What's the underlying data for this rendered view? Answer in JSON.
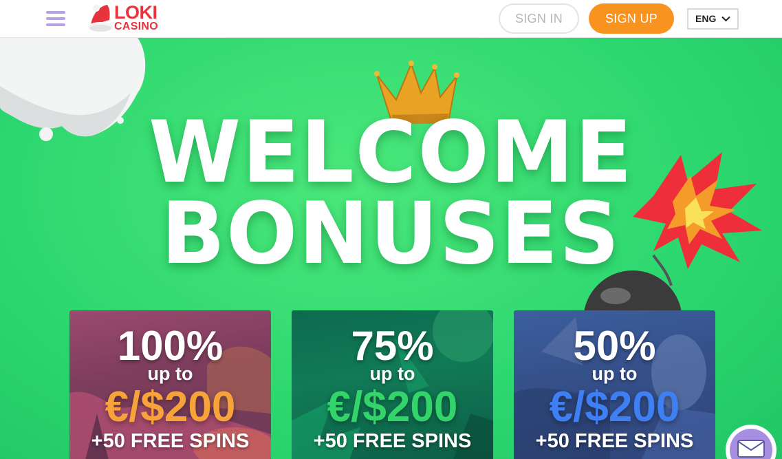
{
  "header": {
    "logo_brand": "LOKI",
    "logo_sub": "CASINO",
    "sign_in_label": "SIGN IN",
    "sign_up_label": "SIGN UP",
    "language": "ENG"
  },
  "hero": {
    "line1": "WELCOME",
    "line2": "BONUSES"
  },
  "cards": [
    {
      "percent": "100%",
      "upto": "up to",
      "amount": "€/$200",
      "spins": "+50 FREE SPINS"
    },
    {
      "percent": "75%",
      "upto": "up to",
      "amount": "€/$200",
      "spins": "+50 FREE SPINS"
    },
    {
      "percent": "50%",
      "upto": "up to",
      "amount": "€/$200",
      "spins": "+50 FREE SPINS"
    }
  ],
  "colors": {
    "accent": "#f7931e",
    "hero_green": "#2ed870",
    "brand_red": "#e8333d",
    "menu_purple": "#b7a2e6"
  },
  "icons": [
    "menu-icon",
    "santa-hat-icon",
    "chevron-down-icon",
    "crown-icon",
    "bomb-icon",
    "mail-icon"
  ]
}
